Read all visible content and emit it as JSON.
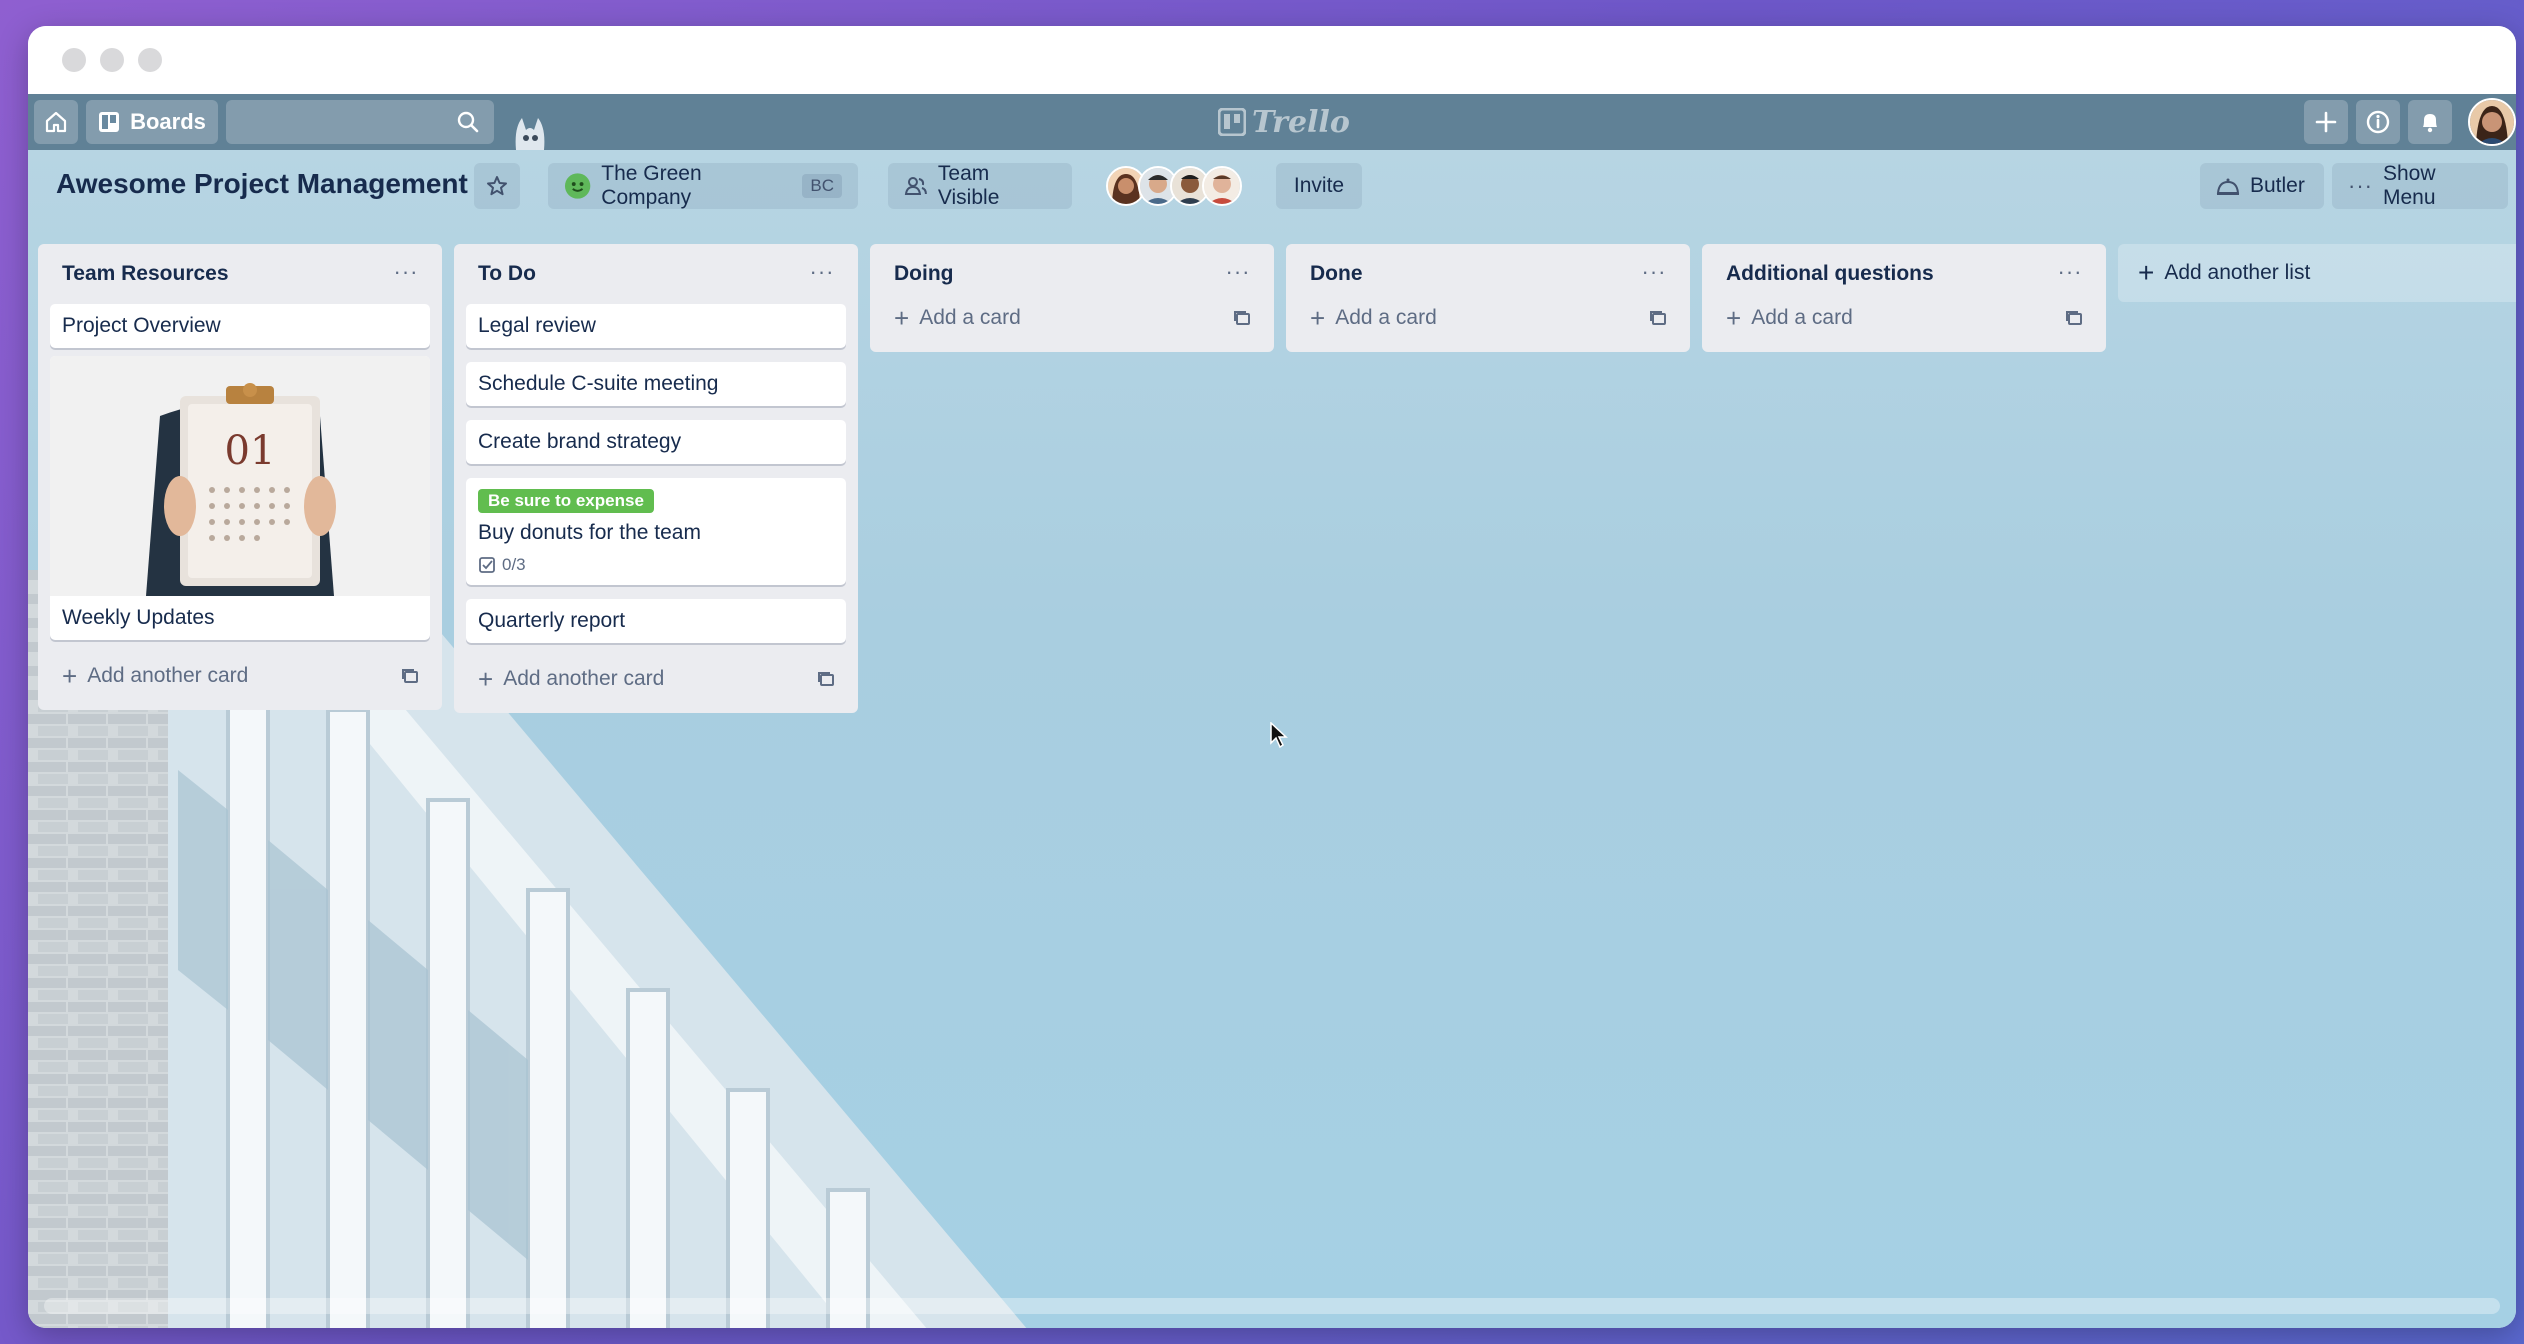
{
  "window": {
    "controls": [
      "close",
      "minimize",
      "zoom"
    ]
  },
  "topbar": {
    "home_icon": "home-icon",
    "boards_label": "Boards",
    "search_placeholder": "",
    "logo_text": "Trello",
    "right_icons": [
      "plus-icon",
      "info-icon",
      "bell-icon",
      "avatar"
    ]
  },
  "header": {
    "board_title": "Awesome Project Management",
    "team_name": "The Green Company",
    "team_badge": "BC",
    "visibility": "Team Visible",
    "invite_label": "Invite",
    "butler_label": "Butler",
    "show_menu_label": "Show Menu"
  },
  "lists": [
    {
      "title": "Team Resources",
      "cards": [
        "Project Overview",
        "Weekly Updates"
      ],
      "add_label": "Add another card"
    },
    {
      "title": "To Do",
      "cards": [
        "Legal review",
        "Schedule C-suite meeting",
        "Create brand strategy",
        "Buy donuts for the team",
        "Quarterly report"
      ],
      "label": "Be sure to expense",
      "checklist": "0/3",
      "add_label": "Add another card"
    },
    {
      "title": "Doing",
      "add_label": "Add a card"
    },
    {
      "title": "Done",
      "add_label": "Add a card"
    },
    {
      "title": "Additional questions",
      "add_label": "Add a card"
    }
  ],
  "add_list_label": "Add another list",
  "cover_image": {
    "number": "01"
  },
  "colors": {
    "topbar": "#52768d",
    "board_bg": "#a9cee0",
    "list_bg": "#ebecf0",
    "label_green": "#61bd4f",
    "text": "#172b4d"
  }
}
